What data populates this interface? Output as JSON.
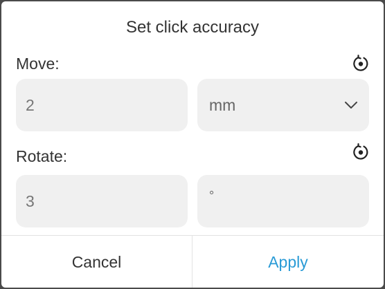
{
  "dialog": {
    "title": "Set click accuracy"
  },
  "move": {
    "label": "Move:",
    "value": "2",
    "unit": "mm",
    "reset_icon": "reset-icon",
    "dropdown_icon": "chevron-down-icon"
  },
  "rotate": {
    "label": "Rotate:",
    "value": "3",
    "unit": "°",
    "reset_icon": "reset-icon"
  },
  "footer": {
    "cancel_label": "Cancel",
    "apply_label": "Apply"
  },
  "colors": {
    "accent": "#2a9bd6",
    "field_bg": "#f0f0f0",
    "text": "#333333"
  }
}
